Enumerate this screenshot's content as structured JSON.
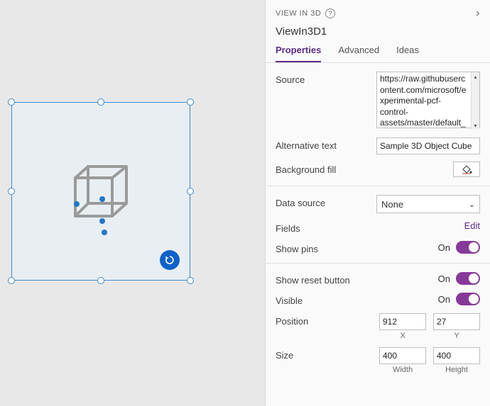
{
  "header": {
    "breadcrumb": "VIEW IN 3D",
    "component_name": "ViewIn3D1"
  },
  "tabs": {
    "properties": "Properties",
    "advanced": "Advanced",
    "ideas": "Ideas"
  },
  "props": {
    "source_label": "Source",
    "source_value": "https://raw.githubusercontent.com/microsoft/experimental-pcf-control-assets/master/default_",
    "alt_label": "Alternative text",
    "alt_value": "Sample 3D Object Cube",
    "bgfill_label": "Background fill",
    "datasource_label": "Data source",
    "datasource_value": "None",
    "fields_label": "Fields",
    "fields_action": "Edit",
    "showpins_label": "Show pins",
    "showpins_state": "On",
    "showreset_label": "Show reset button",
    "showreset_state": "On",
    "visible_label": "Visible",
    "visible_state": "On",
    "position_label": "Position",
    "position_x": "912",
    "position_y": "27",
    "position_x_caption": "X",
    "position_y_caption": "Y",
    "size_label": "Size",
    "size_w": "400",
    "size_h": "400",
    "size_w_caption": "Width",
    "size_h_caption": "Height"
  }
}
